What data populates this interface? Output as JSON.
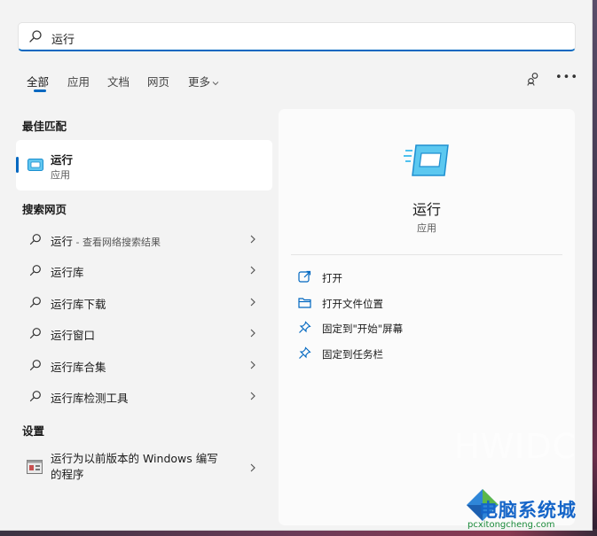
{
  "search": {
    "value": "运行"
  },
  "tabs": [
    {
      "label": "全部",
      "active": true
    },
    {
      "label": "应用"
    },
    {
      "label": "文档"
    },
    {
      "label": "网页"
    },
    {
      "label": "更多"
    }
  ],
  "best_match": {
    "heading": "最佳匹配",
    "name": "运行",
    "type": "应用"
  },
  "web": {
    "heading": "搜索网页",
    "items": [
      {
        "label": "运行",
        "hint": " - 查看网络搜索结果"
      },
      {
        "label": "运行库"
      },
      {
        "label": "运行库下载"
      },
      {
        "label": "运行窗口"
      },
      {
        "label": "运行库合集"
      },
      {
        "label": "运行库检测工具"
      }
    ]
  },
  "settings": {
    "heading": "设置",
    "item": {
      "label": "运行为以前版本的 Windows 编写的程序"
    }
  },
  "detail": {
    "title": "运行",
    "subtitle": "应用",
    "actions": [
      {
        "label": "打开",
        "icon": "open-icon"
      },
      {
        "label": "打开文件位置",
        "icon": "folder-icon"
      },
      {
        "label": "固定到\"开始\"屏幕",
        "icon": "pin-icon"
      },
      {
        "label": "固定到任务栏",
        "icon": "pin-icon"
      }
    ]
  },
  "watermark": {
    "brand": "HWIDC",
    "site_name": "电脑系统城",
    "site_url": "pcxitongcheng.com"
  },
  "colors": {
    "accent": "#0067c0",
    "panel": "#fbfbfb",
    "background": "#f3f3f3"
  }
}
